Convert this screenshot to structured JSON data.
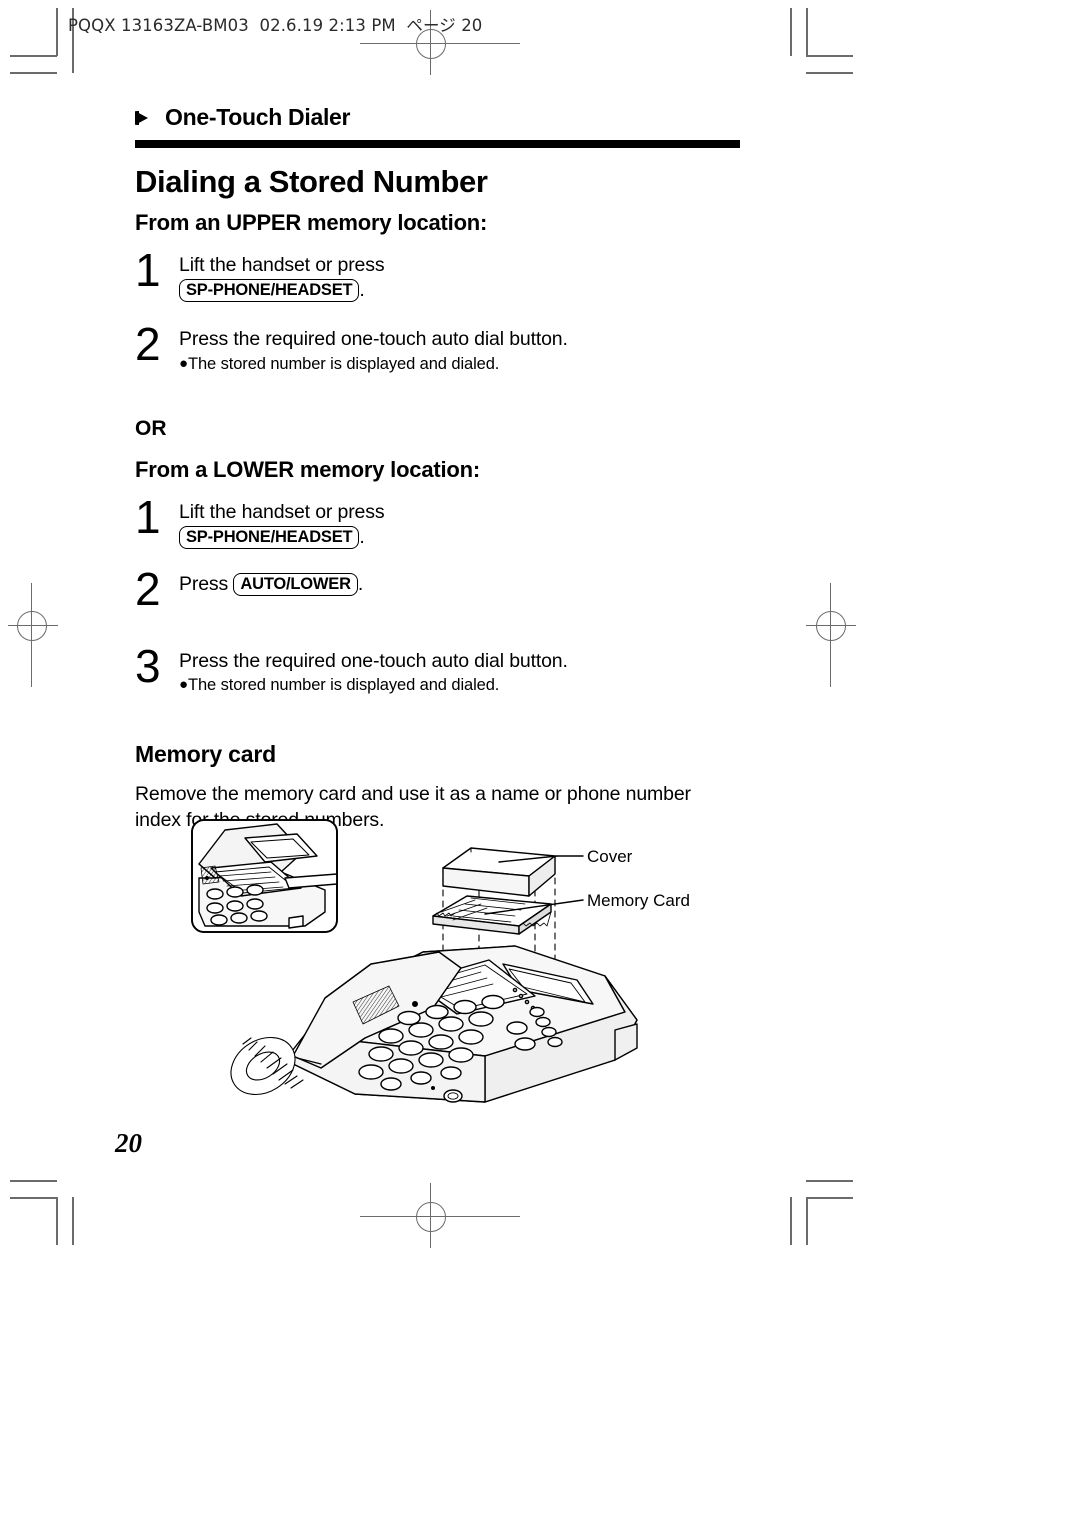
{
  "printer_slug": "PQQX 13163ZA-BM03  02.6.19 2:13 PM  ページ 20",
  "section": {
    "arrow_icon": "right-arrow-icon",
    "label": "One-Touch Dialer"
  },
  "title": "Dialing a Stored Number",
  "upper": {
    "heading": "From an UPPER memory location:",
    "steps": [
      {
        "number": "1",
        "text_before": "Lift the handset or press",
        "key": "SP-PHONE/HEADSET",
        "text_after": ".",
        "bullet": ""
      },
      {
        "number": "2",
        "text_before": "Press the required one-touch auto dial button.",
        "key": "",
        "text_after": "",
        "bullet": "The stored number is displayed and dialed."
      }
    ]
  },
  "or_label": "OR",
  "lower": {
    "heading": "From a LOWER memory location:",
    "steps": [
      {
        "number": "1",
        "text_before": "Lift the handset or press",
        "key": "SP-PHONE/HEADSET",
        "text_after": ".",
        "bullet": ""
      },
      {
        "number": "2",
        "text_before": "Press",
        "key": "AUTO/LOWER",
        "text_after": ".",
        "bullet": ""
      },
      {
        "number": "3",
        "text_before": "Press the required one-touch auto dial button.",
        "key": "",
        "text_after": "",
        "bullet": "The stored number is displayed and dialed."
      }
    ]
  },
  "memory_card": {
    "heading": "Memory card",
    "text": "Remove the memory card and use it as a name or phone number index for the stored numbers."
  },
  "figure": {
    "cover_label": "Cover",
    "memory_card_label": "Memory Card"
  },
  "page_number": "20",
  "colors": {
    "ink": "#000000",
    "crop_mark": "#6b6b6b",
    "figure_shade": "#f2f2f2"
  }
}
